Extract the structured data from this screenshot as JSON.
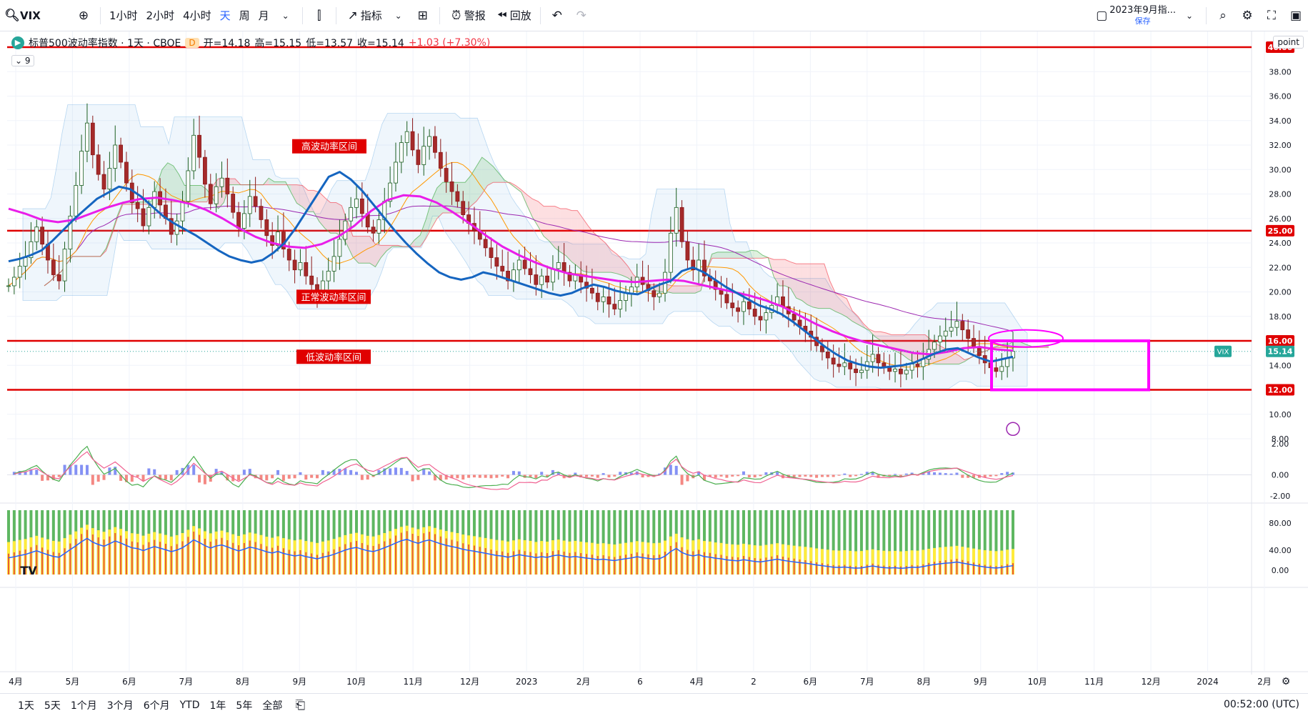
{
  "toolbar": {
    "symbol": "VIX",
    "intervals": [
      "1小时",
      "2小时",
      "4小时",
      "天",
      "周",
      "月"
    ],
    "active_interval": "天",
    "indicators_label": "指标",
    "alert_label": "警报",
    "replay_label": "回放",
    "layout_name": "2023年9月指...",
    "layout_status": "保存"
  },
  "legend": {
    "title": "标普500波动率指数 · 1天 · CBOE",
    "badge": "D",
    "open_label": "开=14.18",
    "high_label": "高=15.15",
    "low_label": "低=13.57",
    "close_label": "收=15.14",
    "change": "+1.03 (+7.30%)",
    "indicator_count": "9"
  },
  "price_scale_button": "point",
  "chart_data": {
    "type": "candlestick",
    "symbol": "VIX",
    "last_price": 15.14,
    "last_price_label": "15.14",
    "ylim": [
      8,
      40
    ],
    "price_ticks": [
      "38.00",
      "36.00",
      "34.00",
      "32.00",
      "30.00",
      "28.00",
      "26.00",
      "24.00",
      "22.00",
      "20.00",
      "18.00",
      "14.00",
      "10.00",
      "8.00"
    ],
    "x_labels": [
      "4月",
      "5月",
      "6月",
      "7月",
      "8月",
      "9月",
      "10月",
      "11月",
      "12月",
      "2023",
      "2月",
      "6",
      "4月",
      "2",
      "6月",
      "7月",
      "8月",
      "9月",
      "10月",
      "11月",
      "12月",
      "2024",
      "2月"
    ],
    "horizontal_lines": [
      {
        "value": 40,
        "label": "40.00",
        "color": "#e00000"
      },
      {
        "value": 25,
        "label": "25.00",
        "color": "#e00000"
      },
      {
        "value": 16,
        "label": "16.00",
        "color": "#e00000"
      },
      {
        "value": 12,
        "label": "12.00",
        "color": "#e00000"
      }
    ],
    "annotations": [
      "高波动率区间",
      "正常波动率区间",
      "低波动率区间"
    ],
    "close_series": [
      20.5,
      21.2,
      22.1,
      22.8,
      24.1,
      25.3,
      23.9,
      22.6,
      21.4,
      20.9,
      23.5,
      26.2,
      28.7,
      31.5,
      33.8,
      31.2,
      29.6,
      28.4,
      30.1,
      32.0,
      30.6,
      28.9,
      27.3,
      26.8,
      25.4,
      26.9,
      28.2,
      27.1,
      26.0,
      24.7,
      25.8,
      27.4,
      29.9,
      32.8,
      31.0,
      28.8,
      27.2,
      28.6,
      29.3,
      28.0,
      26.5,
      25.2,
      26.4,
      27.8,
      27.0,
      25.9,
      24.6,
      23.8,
      24.9,
      23.5,
      22.6,
      21.8,
      22.4,
      21.3,
      20.6,
      19.8,
      20.9,
      21.7,
      22.9,
      24.3,
      25.8,
      26.9,
      27.6,
      26.4,
      25.3,
      24.8,
      25.9,
      27.4,
      28.9,
      30.6,
      32.2,
      33.1,
      31.6,
      30.4,
      31.9,
      32.7,
      31.4,
      30.1,
      29.0,
      28.2,
      27.4,
      26.3,
      25.6,
      25.0,
      24.3,
      23.6,
      22.8,
      22.1,
      21.7,
      20.9,
      21.8,
      22.6,
      21.9,
      21.4,
      20.6,
      21.3,
      20.8,
      21.9,
      22.4,
      21.6,
      20.9,
      21.4,
      20.8,
      20.3,
      19.9,
      19.2,
      19.6,
      19.0,
      18.6,
      19.3,
      19.9,
      20.4,
      21.2,
      20.6,
      20.1,
      19.6,
      19.9,
      21.6,
      24.8,
      26.9,
      24.1,
      22.6,
      21.8,
      22.6,
      21.3,
      20.9,
      20.2,
      19.8,
      19.1,
      18.7,
      18.4,
      19.2,
      18.6,
      18.0,
      17.7,
      18.3,
      18.9,
      19.6,
      18.8,
      18.2,
      17.7,
      17.2,
      16.8,
      16.3,
      15.6,
      15.1,
      14.6,
      14.1,
      13.9,
      14.2,
      13.7,
      13.4,
      13.6,
      14.3,
      14.9,
      14.2,
      13.8,
      13.5,
      13.7,
      13.3,
      13.6,
      14.1,
      13.9,
      14.5,
      15.3,
      15.9,
      16.4,
      16.8,
      17.1,
      17.6,
      16.9,
      16.2,
      15.5,
      14.8,
      14.2,
      13.8,
      13.5,
      13.9,
      14.6,
      15.14
    ],
    "ma_blue_series": [
      22.5,
      22.7,
      23.0,
      23.4,
      24.2,
      25.1,
      26.0,
      26.8,
      27.6,
      28.1,
      28.6,
      28.4,
      27.8,
      27.0,
      26.2,
      25.6,
      25.1,
      24.6,
      24.0,
      23.4,
      22.9,
      22.6,
      22.4,
      22.6,
      23.2,
      24.0,
      25.2,
      26.6,
      28.0,
      29.4,
      29.8,
      29.2,
      28.3,
      27.2,
      26.1,
      25.0,
      24.0,
      23.1,
      22.3,
      21.6,
      21.2,
      21.0,
      21.2,
      21.6,
      21.4,
      21.1,
      20.8,
      20.5,
      20.2,
      19.9,
      19.7,
      19.9,
      20.3,
      20.6,
      20.4,
      20.1,
      19.9,
      19.8,
      20.2,
      20.6,
      20.9,
      21.7,
      22.0,
      21.6,
      21.0,
      20.4,
      19.9,
      19.4,
      18.9,
      18.6,
      18.2,
      17.6,
      16.9,
      16.2,
      15.5,
      14.9,
      14.4,
      14.1,
      13.9,
      13.8,
      13.9,
      14.0,
      14.2,
      14.6,
      15.0,
      15.3,
      15.4,
      15.0,
      14.6,
      14.3,
      14.5,
      14.7
    ],
    "ma_magenta_series": [
      26.8,
      26.4,
      25.9,
      25.7,
      25.9,
      26.4,
      26.9,
      27.3,
      27.6,
      27.7,
      27.5,
      27.2,
      26.7,
      26.0,
      25.2,
      24.5,
      24.0,
      23.7,
      23.6,
      23.9,
      24.5,
      25.4,
      26.6,
      27.5,
      27.9,
      27.8,
      27.3,
      26.5,
      25.6,
      24.6,
      23.7,
      23.0,
      22.4,
      21.9,
      21.5,
      21.3,
      21.1,
      20.9,
      20.8,
      20.9,
      21.0,
      20.9,
      20.6,
      20.3,
      20.0,
      19.7,
      19.3,
      18.8,
      18.1,
      17.4,
      16.8,
      16.3,
      15.9,
      15.6,
      15.3,
      15.0,
      14.9,
      15.1,
      15.4,
      15.5,
      15.3,
      15.2
    ]
  },
  "bottom": {
    "ranges": [
      "1天",
      "5天",
      "1个月",
      "3个月",
      "6个月",
      "YTD",
      "1年",
      "5年",
      "全部"
    ],
    "time": "00:52:00 (UTC)"
  }
}
